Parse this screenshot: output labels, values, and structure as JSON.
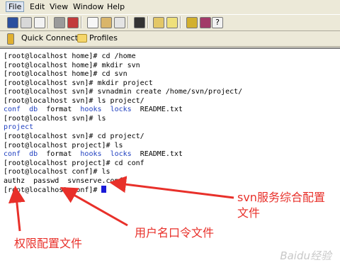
{
  "menu": [
    "File",
    "Edit",
    "View",
    "Window",
    "Help"
  ],
  "quick_connect_label": "Quick Connect",
  "profiles_label": "Profiles",
  "terminal_lines": [
    [
      {
        "t": "[root@localhost home]# cd /home"
      }
    ],
    [
      {
        "t": "[root@localhost home]# mkdir svn"
      }
    ],
    [
      {
        "t": "[root@localhost home]# cd svn"
      }
    ],
    [
      {
        "t": "[root@localhost svn]# mkdir project"
      }
    ],
    [
      {
        "t": "[root@localhost svn]# svnadmin create /home/svn/project/"
      }
    ],
    [
      {
        "t": "[root@localhost svn]# ls project/"
      }
    ],
    [
      {
        "t": "conf",
        "c": "blue"
      },
      {
        "t": "  "
      },
      {
        "t": "db",
        "c": "blue"
      },
      {
        "t": "  format  "
      },
      {
        "t": "hooks",
        "c": "blue"
      },
      {
        "t": "  "
      },
      {
        "t": "locks",
        "c": "blue"
      },
      {
        "t": "  README.txt"
      }
    ],
    [
      {
        "t": "[root@localhost svn]# ls"
      }
    ],
    [
      {
        "t": "project",
        "c": "blue"
      }
    ],
    [
      {
        "t": "[root@localhost svn]# cd project/"
      }
    ],
    [
      {
        "t": "[root@localhost project]# ls"
      }
    ],
    [
      {
        "t": "conf",
        "c": "blue"
      },
      {
        "t": "  "
      },
      {
        "t": "db",
        "c": "blue"
      },
      {
        "t": "  format  "
      },
      {
        "t": "hooks",
        "c": "blue"
      },
      {
        "t": "  "
      },
      {
        "t": "locks",
        "c": "blue"
      },
      {
        "t": "  README.txt"
      }
    ],
    [
      {
        "t": "[root@localhost project]# cd conf"
      }
    ],
    [
      {
        "t": "[root@localhost conf]# ls"
      }
    ],
    [
      {
        "t": "authz  passwd  svnserve.conf"
      }
    ],
    [
      {
        "t": "[root@localhost conf]# "
      }
    ]
  ],
  "annotations": {
    "svnserve": "svn服务综合配置\n文件",
    "passwd": "用户名口令文件",
    "authz": "权限配置文件"
  },
  "watermark": "Baidu经验",
  "colors": {
    "annotation": "#e8302a",
    "directory": "#1f3fc0",
    "cursor": "#1a1ad8"
  },
  "icons": [
    "save-icon",
    "print-icon",
    "print-preview-icon",
    "disconnect-icon",
    "connect-icon",
    "copy-icon",
    "paste-icon",
    "copy-paste-icon",
    "find-icon",
    "file-transfer-icon",
    "settings-icon",
    "keys-icon",
    "help-icon",
    "quick-connect-icon",
    "folder-icon"
  ]
}
